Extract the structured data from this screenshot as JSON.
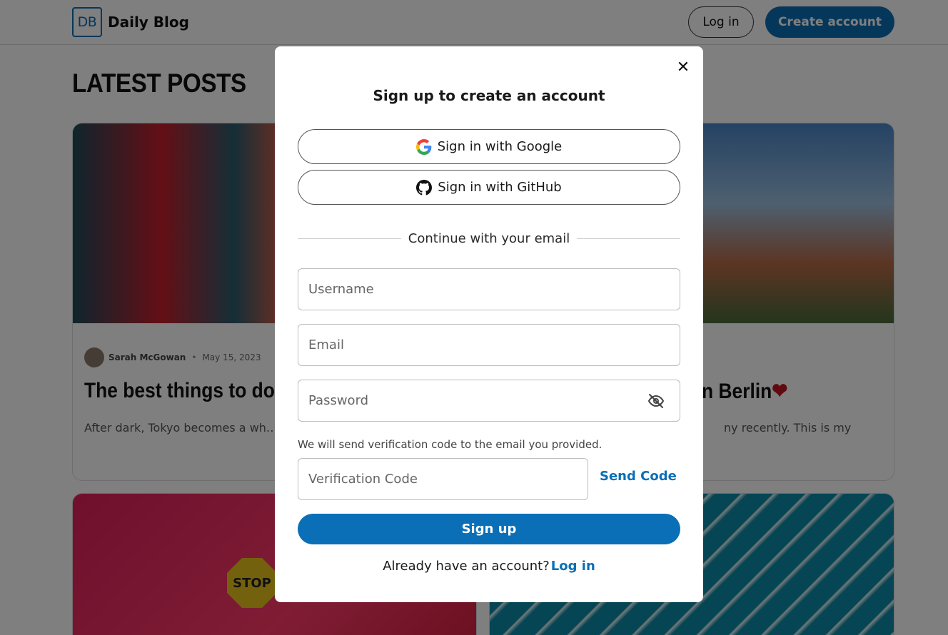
{
  "header": {
    "logo_mark": "DB",
    "brand": "Daily Blog",
    "login_label": "Log in",
    "create_label": "Create account"
  },
  "page": {
    "title": "LATEST POSTS"
  },
  "posts": [
    {
      "author": "Sarah McGowan",
      "separator": "•",
      "date": "May 15, 2023",
      "title": "The best things to do",
      "excerpt": "After dark, Tokyo becomes a wh… things to do in Tokyo at night."
    },
    {
      "title": "n Berlin",
      "title_emoji": "❤",
      "excerpt": "ny recently. This is my"
    },
    {
      "image_text": "STOP"
    }
  ],
  "modal": {
    "close_glyph": "✕",
    "title": "Sign up to create an account",
    "google_label": "Sign in with Google",
    "github_label": "Sign in with GitHub",
    "divider_text": "Continue with your email",
    "username_placeholder": "Username",
    "email_placeholder": "Email",
    "password_placeholder": "Password",
    "hint": "We will send verification code to the email you provided.",
    "code_placeholder": "Verification Code",
    "send_code_label": "Send Code",
    "signup_label": "Sign up",
    "footer_text": "Already have an account?",
    "footer_link": "Log in"
  },
  "colors": {
    "accent": "#0a6fb6",
    "overlay": "rgba(0,0,0,0.5)"
  },
  "icons": {
    "close": "close-icon",
    "google": "google-icon",
    "github": "github-icon",
    "password_toggle": "eye-off-icon"
  }
}
